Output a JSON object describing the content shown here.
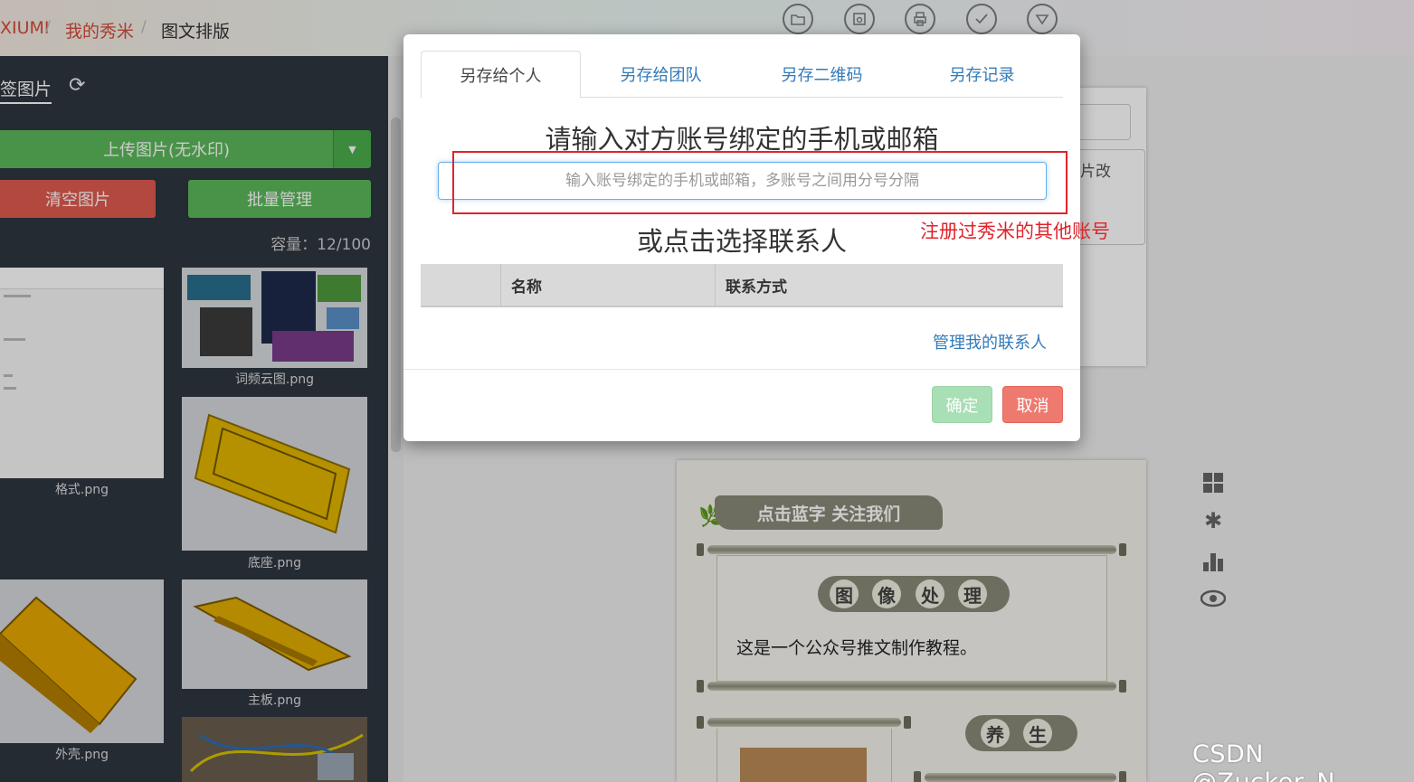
{
  "breadcrumb": {
    "item1": "XIUMI",
    "sep1": "/",
    "item2": "我的秀米",
    "sep2": "/",
    "item3": "图文排版"
  },
  "toolbar_icons": [
    "folder-icon",
    "save-icon",
    "print-icon",
    "check-icon",
    "dropdown-icon"
  ],
  "left_panel": {
    "tab_label": "签图片",
    "upload_label": "上传图片(无水印)",
    "clear_label": "清空图片",
    "batch_label": "批量管理",
    "capacity": "容量：12/100",
    "images": [
      {
        "caption": "格式.png"
      },
      {
        "caption": "词频云图.png"
      },
      {
        "caption": "底座.png"
      },
      {
        "caption": "外壳.png"
      },
      {
        "caption": "主板.png"
      }
    ]
  },
  "right_card": {
    "partial_text": "片改"
  },
  "preview": {
    "banner": "点击蓝字 关注我们",
    "section1_chars": [
      "图",
      "像",
      "处",
      "理"
    ],
    "body_text": "这是一个公众号推文制作教程。",
    "section2_chars": [
      "养",
      "生"
    ]
  },
  "watermark": "CSDN @Zucker_N",
  "modal": {
    "tabs": [
      "另存给个人",
      "另存给团队",
      "另存二维码",
      "另存记录"
    ],
    "active_tab": 0,
    "heading": "请输入对方账号绑定的手机或邮箱",
    "input_placeholder": "输入账号绑定的手机或邮箱，多账号之间用分号分隔",
    "subheading": "或点击选择联系人",
    "table_headers": [
      "",
      "名称",
      "联系方式"
    ],
    "manage_link": "管理我的联系人",
    "ok_label": "确定",
    "cancel_label": "取消"
  },
  "annotation": "注册过秀米的其他账号",
  "colors": {
    "accent_blue": "#337ab7",
    "success_green": "#5cb85c",
    "danger_red": "#e05a4f",
    "annotation_red": "#e0242c"
  }
}
